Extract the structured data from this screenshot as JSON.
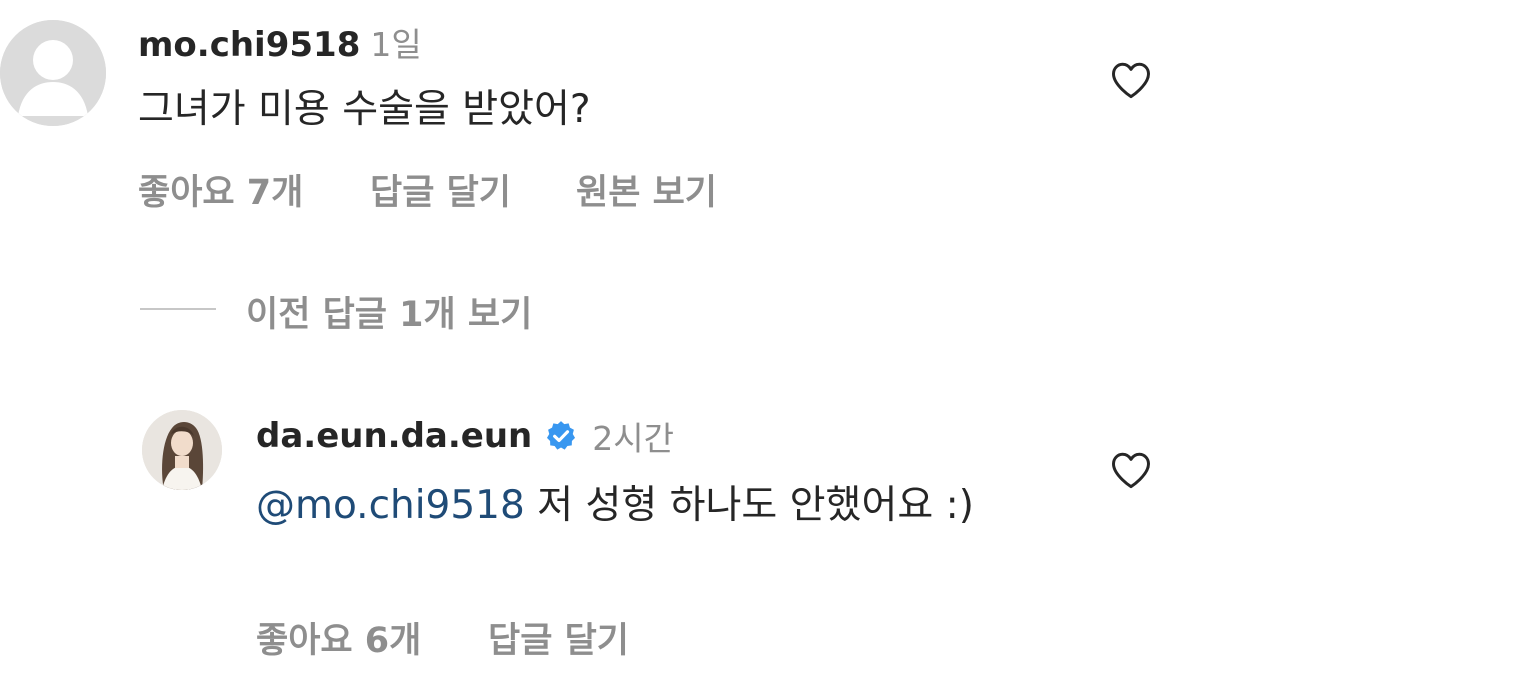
{
  "comments": [
    {
      "username": "mo.chi9518",
      "time": "1일",
      "text": "그녀가 미용 수술을 받았어?",
      "likes": "좋아요 7개",
      "reply": "답글 달기",
      "see_original": "원본 보기",
      "avatar_icon": "default-avatar-icon",
      "like_icon": "heart-outline-icon"
    },
    {
      "username": "da.eun.da.eun",
      "verified_icon": "verified-badge-icon",
      "time": "2시간",
      "mention": "@mo.chi9518",
      "text": " 저 성형 하나도 안했어요 :)",
      "likes": "좋아요 6개",
      "reply": "답글 달기",
      "avatar_icon": "profile-photo",
      "like_icon": "heart-outline-icon"
    }
  ],
  "view_previous_replies": "이전 답글 1개 보기",
  "colors": {
    "primary_text": "#262626",
    "secondary_text": "#8e8e8e",
    "mention": "#1f4b77",
    "verified_blue": "#3897f0",
    "avatar_placeholder": "#dbdbdb"
  }
}
